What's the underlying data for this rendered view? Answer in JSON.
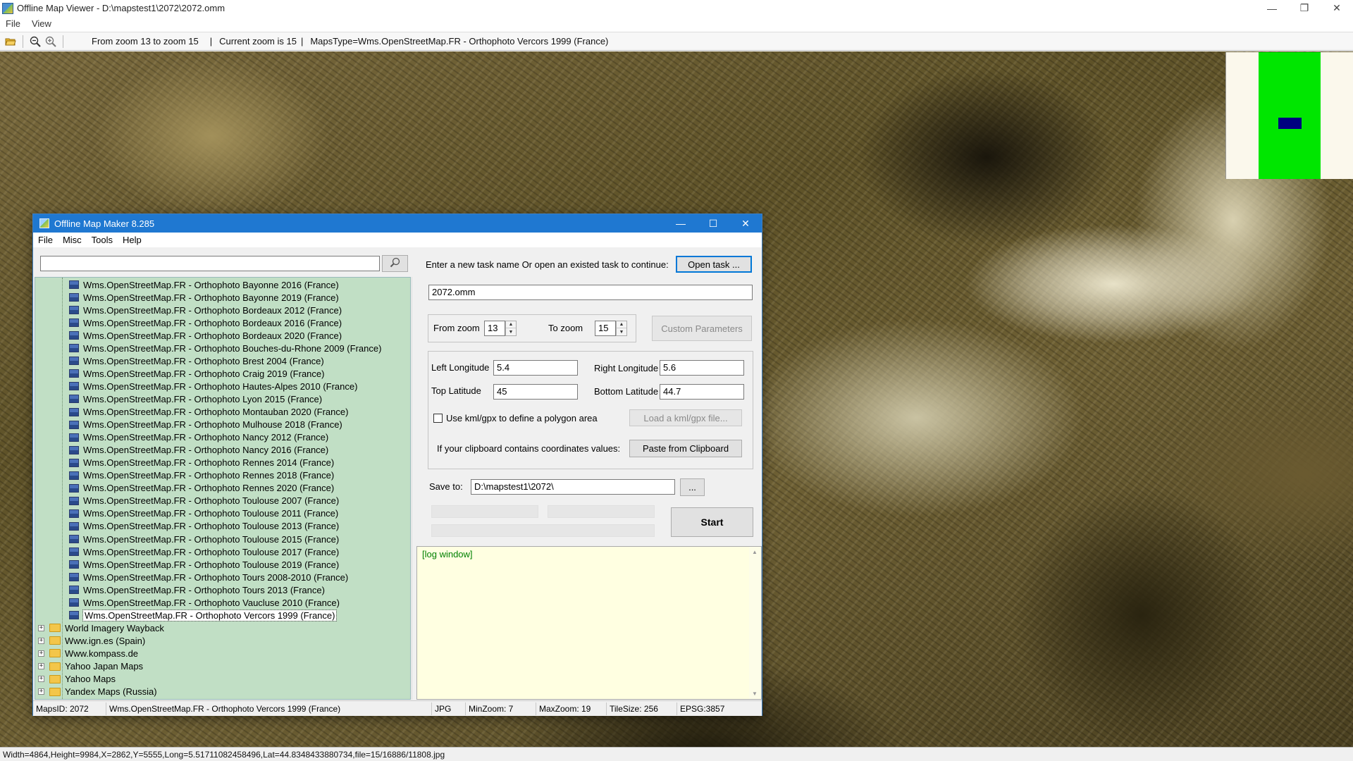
{
  "viewer": {
    "title": "Offline Map Viewer - D:\\mapstest1\\2072\\2072.omm",
    "menu": [
      "File",
      "View"
    ],
    "toolbar": {
      "zoom_range": "From zoom 13 to zoom 15",
      "current_zoom": "Current zoom is 15",
      "maps_type": "MapsType=Wms.OpenStreetMap.FR - Orthophoto Vercors 1999 (France)",
      "sep": "|"
    },
    "status": "Width=4864,Height=9984,X=2862,Y=5555,Long=5.51711082458496,Lat=44.8348433880734,file=15/16886/11808.jpg",
    "minimap_colors": {
      "background": "#fbf8ec",
      "area": "#00e600",
      "view": "#000080"
    }
  },
  "maker": {
    "title": "Offline Map Maker 8.285",
    "menu": [
      "File",
      "Misc",
      "Tools",
      "Help"
    ],
    "search": {
      "value": "",
      "placeholder": ""
    },
    "tree_items": [
      {
        "label": "Wms.OpenStreetMap.FR - Orthophoto Bayonne 2016 (France)",
        "kind": "map"
      },
      {
        "label": "Wms.OpenStreetMap.FR - Orthophoto Bayonne 2019 (France)",
        "kind": "map"
      },
      {
        "label": "Wms.OpenStreetMap.FR - Orthophoto Bordeaux 2012 (France)",
        "kind": "map"
      },
      {
        "label": "Wms.OpenStreetMap.FR - Orthophoto Bordeaux 2016 (France)",
        "kind": "map"
      },
      {
        "label": "Wms.OpenStreetMap.FR - Orthophoto Bordeaux 2020 (France)",
        "kind": "map"
      },
      {
        "label": "Wms.OpenStreetMap.FR - Orthophoto Bouches-du-Rhone 2009 (France)",
        "kind": "map"
      },
      {
        "label": "Wms.OpenStreetMap.FR - Orthophoto Brest 2004 (France)",
        "kind": "map"
      },
      {
        "label": "Wms.OpenStreetMap.FR - Orthophoto Craig 2019 (France)",
        "kind": "map"
      },
      {
        "label": "Wms.OpenStreetMap.FR - Orthophoto Hautes-Alpes 2010 (France)",
        "kind": "map"
      },
      {
        "label": "Wms.OpenStreetMap.FR - Orthophoto Lyon 2015 (France)",
        "kind": "map"
      },
      {
        "label": "Wms.OpenStreetMap.FR - Orthophoto Montauban 2020 (France)",
        "kind": "map"
      },
      {
        "label": "Wms.OpenStreetMap.FR - Orthophoto Mulhouse 2018 (France)",
        "kind": "map"
      },
      {
        "label": "Wms.OpenStreetMap.FR - Orthophoto Nancy 2012 (France)",
        "kind": "map"
      },
      {
        "label": "Wms.OpenStreetMap.FR - Orthophoto Nancy 2016 (France)",
        "kind": "map"
      },
      {
        "label": "Wms.OpenStreetMap.FR - Orthophoto Rennes 2014 (France)",
        "kind": "map"
      },
      {
        "label": "Wms.OpenStreetMap.FR - Orthophoto Rennes 2018 (France)",
        "kind": "map"
      },
      {
        "label": "Wms.OpenStreetMap.FR - Orthophoto Rennes 2020 (France)",
        "kind": "map"
      },
      {
        "label": "Wms.OpenStreetMap.FR - Orthophoto Toulouse 2007 (France)",
        "kind": "map"
      },
      {
        "label": "Wms.OpenStreetMap.FR - Orthophoto Toulouse 2011 (France)",
        "kind": "map"
      },
      {
        "label": "Wms.OpenStreetMap.FR - Orthophoto Toulouse 2013 (France)",
        "kind": "map"
      },
      {
        "label": "Wms.OpenStreetMap.FR - Orthophoto Toulouse 2015 (France)",
        "kind": "map"
      },
      {
        "label": "Wms.OpenStreetMap.FR - Orthophoto Toulouse 2017 (France)",
        "kind": "map"
      },
      {
        "label": "Wms.OpenStreetMap.FR - Orthophoto Toulouse 2019 (France)",
        "kind": "map"
      },
      {
        "label": "Wms.OpenStreetMap.FR - Orthophoto Tours 2008-2010 (France)",
        "kind": "map"
      },
      {
        "label": "Wms.OpenStreetMap.FR - Orthophoto Tours 2013 (France)",
        "kind": "map"
      },
      {
        "label": "Wms.OpenStreetMap.FR - Orthophoto Vaucluse 2010 (France)",
        "kind": "map"
      },
      {
        "label": "Wms.OpenStreetMap.FR - Orthophoto Vercors 1999 (France)",
        "kind": "map",
        "selected": true
      },
      {
        "label": "World Imagery Wayback",
        "kind": "folder"
      },
      {
        "label": "Www.ign.es (Spain)",
        "kind": "folder"
      },
      {
        "label": "Www.kompass.de",
        "kind": "folder"
      },
      {
        "label": "Yahoo Japan Maps",
        "kind": "folder"
      },
      {
        "label": "Yahoo Maps",
        "kind": "folder"
      },
      {
        "label": "Yandex Maps (Russia)",
        "kind": "folder"
      }
    ],
    "task_prompt": "Enter a new task name Or open an existed task to continue:",
    "open_task_label": "Open task ...",
    "task_name": "2072.omm",
    "from_zoom_label": "From zoom",
    "from_zoom": "13",
    "to_zoom_label": "To zoom",
    "to_zoom": "15",
    "custom_params_label": "Custom Parameters",
    "left_lon_label": "Left Longitude",
    "left_lon": "5.4",
    "right_lon_label": "Right Longitude",
    "right_lon": "5.6",
    "top_lat_label": "Top Latitude",
    "top_lat": "45",
    "bottom_lat_label": "Bottom Latitude",
    "bottom_lat": "44.7",
    "kml_checkbox_label": "Use kml/gpx to define a polygon area",
    "kml_checked": false,
    "load_kml_label": "Load a kml/gpx file...",
    "clipboard_text": "If your clipboard contains coordinates values:",
    "paste_label": "Paste from Clipboard",
    "save_to_label": "Save to:",
    "save_to": "D:\\mapstest1\\2072\\",
    "browse_label": "...",
    "start_label": "Start",
    "log_text": "[log window]",
    "status": {
      "maps_id": "MapsID: 2072",
      "maps_name": "Wms.OpenStreetMap.FR - Orthophoto Vercors 1999 (France)",
      "format": "JPG",
      "min_zoom": "MinZoom: 7",
      "max_zoom": "MaxZoom: 19",
      "tile_size": "TileSize: 256",
      "epsg": "EPSG:3857"
    }
  }
}
